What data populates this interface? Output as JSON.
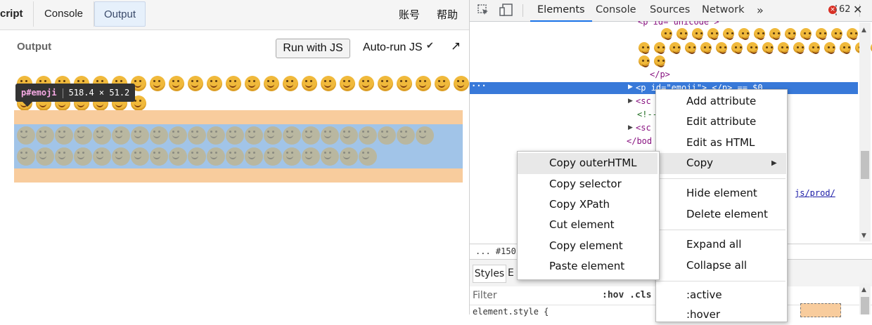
{
  "left_pane": {
    "tabs": [
      "cript",
      "Console",
      "Output"
    ],
    "right_links": [
      "账号",
      "帮助"
    ],
    "output_label": "Output",
    "run_button": "Run with JS",
    "autorun_label": "Auto-run JS",
    "autorun_checked": "✔",
    "popout_icon": "↗",
    "tooltip": {
      "tag": "p#emoji",
      "size": "518.4 × 51.2"
    }
  },
  "devtools": {
    "tabs": [
      "Elements",
      "Console",
      "Sources",
      "Network"
    ],
    "more_tabs": "»",
    "error_count": "62",
    "error_icon": "×",
    "menu_icon": "⋮",
    "close_icon": "✕",
    "code": {
      "line1": "<p id=\"unicode\">",
      "line_close_p": "</p>",
      "selected": "<p id=\"emoji\">…</p> == $0",
      "sc1": "<sc",
      "comment": "<!--",
      "sc2": "<sc",
      "bod": "</bod",
      "link": "js/prod/"
    },
    "breadcrumb": "...   #150",
    "styles_tab": "Styles",
    "styles_tab_b": "E",
    "filter_placeholder": "Filter",
    "hov": ":hov  .cls",
    "element_style": "element.style {"
  },
  "context_menu": {
    "items": [
      "Add attribute",
      "Edit attribute",
      "Edit as HTML",
      "Copy",
      "Hide element",
      "Delete element",
      "Expand all",
      "Collapse all",
      ":active",
      ":hover"
    ],
    "submenu_arrow": "▶"
  },
  "copy_submenu": {
    "items": [
      "Copy outerHTML",
      "Copy selector",
      "Copy XPath",
      "Cut element",
      "Copy element",
      "Paste element"
    ]
  }
}
